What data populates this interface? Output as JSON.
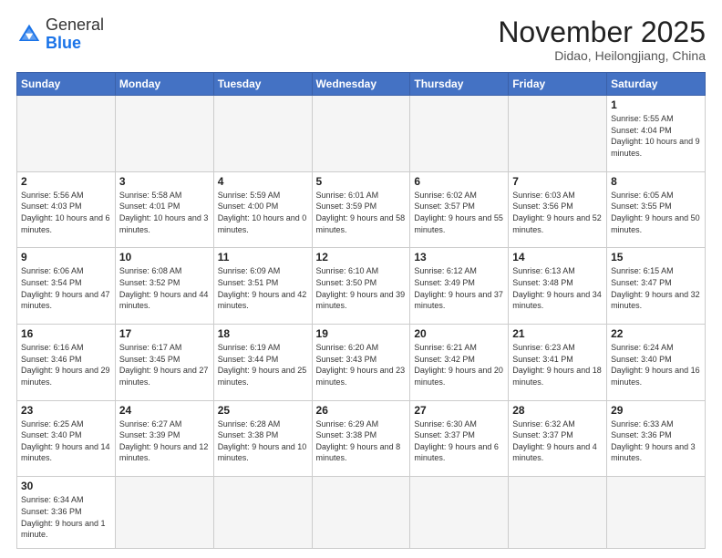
{
  "header": {
    "logo_general": "General",
    "logo_blue": "Blue",
    "month_title": "November 2025",
    "subtitle": "Didao, Heilongjiang, China"
  },
  "weekdays": [
    "Sunday",
    "Monday",
    "Tuesday",
    "Wednesday",
    "Thursday",
    "Friday",
    "Saturday"
  ],
  "weeks": [
    [
      {
        "day": "",
        "info": ""
      },
      {
        "day": "",
        "info": ""
      },
      {
        "day": "",
        "info": ""
      },
      {
        "day": "",
        "info": ""
      },
      {
        "day": "",
        "info": ""
      },
      {
        "day": "",
        "info": ""
      },
      {
        "day": "1",
        "info": "Sunrise: 5:55 AM\nSunset: 4:04 PM\nDaylight: 10 hours\nand 9 minutes."
      }
    ],
    [
      {
        "day": "2",
        "info": "Sunrise: 5:56 AM\nSunset: 4:03 PM\nDaylight: 10 hours\nand 6 minutes."
      },
      {
        "day": "3",
        "info": "Sunrise: 5:58 AM\nSunset: 4:01 PM\nDaylight: 10 hours\nand 3 minutes."
      },
      {
        "day": "4",
        "info": "Sunrise: 5:59 AM\nSunset: 4:00 PM\nDaylight: 10 hours\nand 0 minutes."
      },
      {
        "day": "5",
        "info": "Sunrise: 6:01 AM\nSunset: 3:59 PM\nDaylight: 9 hours\nand 58 minutes."
      },
      {
        "day": "6",
        "info": "Sunrise: 6:02 AM\nSunset: 3:57 PM\nDaylight: 9 hours\nand 55 minutes."
      },
      {
        "day": "7",
        "info": "Sunrise: 6:03 AM\nSunset: 3:56 PM\nDaylight: 9 hours\nand 52 minutes."
      },
      {
        "day": "8",
        "info": "Sunrise: 6:05 AM\nSunset: 3:55 PM\nDaylight: 9 hours\nand 50 minutes."
      }
    ],
    [
      {
        "day": "9",
        "info": "Sunrise: 6:06 AM\nSunset: 3:54 PM\nDaylight: 9 hours\nand 47 minutes."
      },
      {
        "day": "10",
        "info": "Sunrise: 6:08 AM\nSunset: 3:52 PM\nDaylight: 9 hours\nand 44 minutes."
      },
      {
        "day": "11",
        "info": "Sunrise: 6:09 AM\nSunset: 3:51 PM\nDaylight: 9 hours\nand 42 minutes."
      },
      {
        "day": "12",
        "info": "Sunrise: 6:10 AM\nSunset: 3:50 PM\nDaylight: 9 hours\nand 39 minutes."
      },
      {
        "day": "13",
        "info": "Sunrise: 6:12 AM\nSunset: 3:49 PM\nDaylight: 9 hours\nand 37 minutes."
      },
      {
        "day": "14",
        "info": "Sunrise: 6:13 AM\nSunset: 3:48 PM\nDaylight: 9 hours\nand 34 minutes."
      },
      {
        "day": "15",
        "info": "Sunrise: 6:15 AM\nSunset: 3:47 PM\nDaylight: 9 hours\nand 32 minutes."
      }
    ],
    [
      {
        "day": "16",
        "info": "Sunrise: 6:16 AM\nSunset: 3:46 PM\nDaylight: 9 hours\nand 29 minutes."
      },
      {
        "day": "17",
        "info": "Sunrise: 6:17 AM\nSunset: 3:45 PM\nDaylight: 9 hours\nand 27 minutes."
      },
      {
        "day": "18",
        "info": "Sunrise: 6:19 AM\nSunset: 3:44 PM\nDaylight: 9 hours\nand 25 minutes."
      },
      {
        "day": "19",
        "info": "Sunrise: 6:20 AM\nSunset: 3:43 PM\nDaylight: 9 hours\nand 23 minutes."
      },
      {
        "day": "20",
        "info": "Sunrise: 6:21 AM\nSunset: 3:42 PM\nDaylight: 9 hours\nand 20 minutes."
      },
      {
        "day": "21",
        "info": "Sunrise: 6:23 AM\nSunset: 3:41 PM\nDaylight: 9 hours\nand 18 minutes."
      },
      {
        "day": "22",
        "info": "Sunrise: 6:24 AM\nSunset: 3:40 PM\nDaylight: 9 hours\nand 16 minutes."
      }
    ],
    [
      {
        "day": "23",
        "info": "Sunrise: 6:25 AM\nSunset: 3:40 PM\nDaylight: 9 hours\nand 14 minutes."
      },
      {
        "day": "24",
        "info": "Sunrise: 6:27 AM\nSunset: 3:39 PM\nDaylight: 9 hours\nand 12 minutes."
      },
      {
        "day": "25",
        "info": "Sunrise: 6:28 AM\nSunset: 3:38 PM\nDaylight: 9 hours\nand 10 minutes."
      },
      {
        "day": "26",
        "info": "Sunrise: 6:29 AM\nSunset: 3:38 PM\nDaylight: 9 hours\nand 8 minutes."
      },
      {
        "day": "27",
        "info": "Sunrise: 6:30 AM\nSunset: 3:37 PM\nDaylight: 9 hours\nand 6 minutes."
      },
      {
        "day": "28",
        "info": "Sunrise: 6:32 AM\nSunset: 3:37 PM\nDaylight: 9 hours\nand 4 minutes."
      },
      {
        "day": "29",
        "info": "Sunrise: 6:33 AM\nSunset: 3:36 PM\nDaylight: 9 hours\nand 3 minutes."
      }
    ],
    [
      {
        "day": "30",
        "info": "Sunrise: 6:34 AM\nSunset: 3:36 PM\nDaylight: 9 hours\nand 1 minute."
      },
      {
        "day": "",
        "info": ""
      },
      {
        "day": "",
        "info": ""
      },
      {
        "day": "",
        "info": ""
      },
      {
        "day": "",
        "info": ""
      },
      {
        "day": "",
        "info": ""
      },
      {
        "day": "",
        "info": ""
      }
    ]
  ]
}
